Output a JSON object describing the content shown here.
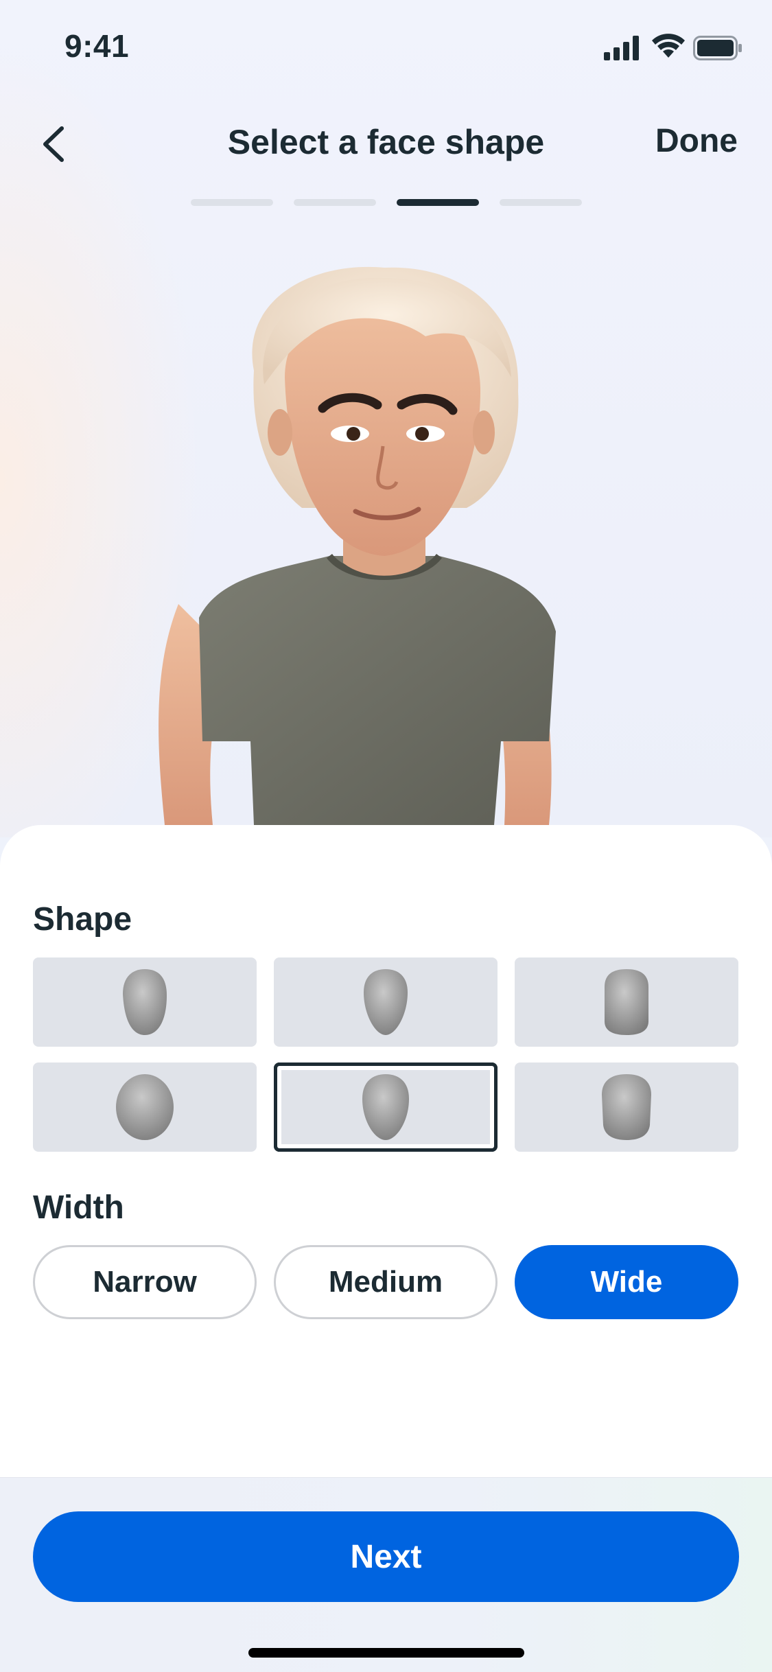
{
  "status_bar": {
    "time": "9:41"
  },
  "header": {
    "title": "Select a face shape",
    "done_label": "Done",
    "steps_total": 4,
    "step_active": 3
  },
  "shape": {
    "label": "Shape",
    "options": [
      "face-shape-1",
      "face-shape-2",
      "face-shape-3",
      "face-shape-4",
      "face-shape-5",
      "face-shape-6"
    ],
    "selected_index": 4
  },
  "width": {
    "label": "Width",
    "options": [
      "Narrow",
      "Medium",
      "Wide"
    ],
    "selected": "Wide"
  },
  "footer": {
    "next_label": "Next"
  },
  "colors": {
    "accent": "#0064e0",
    "text": "#1c2b33",
    "tile": "#e0e3e9"
  }
}
